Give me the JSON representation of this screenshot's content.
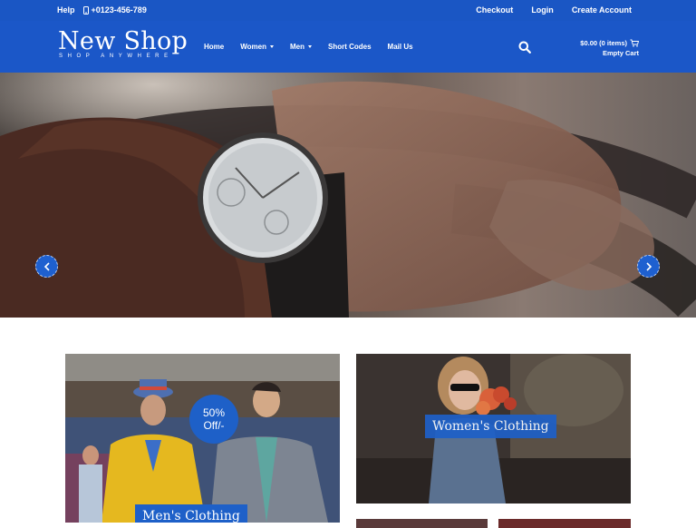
{
  "topbar": {
    "help": "Help",
    "phone": "+0123-456-789",
    "links": [
      "Checkout",
      "Login",
      "Create Account"
    ]
  },
  "header": {
    "logo_name": "New Shop",
    "logo_tagline": "SHOP ANYWHERE",
    "nav": [
      {
        "label": "Home",
        "dropdown": false
      },
      {
        "label": "Women",
        "dropdown": true
      },
      {
        "label": "Men",
        "dropdown": true
      },
      {
        "label": "Short Codes",
        "dropdown": false
      },
      {
        "label": "Mail Us",
        "dropdown": false
      }
    ],
    "cart_total": "$0.00 (0 items)",
    "cart_status": "Empty Cart"
  },
  "categories": {
    "men_label": "Men's Clothing",
    "discount_line1": "50%",
    "discount_line2": "Off/-",
    "women_label": "Women's Clothing"
  },
  "colors": {
    "brand": "#1b57c8",
    "accent": "#1e60c8"
  }
}
